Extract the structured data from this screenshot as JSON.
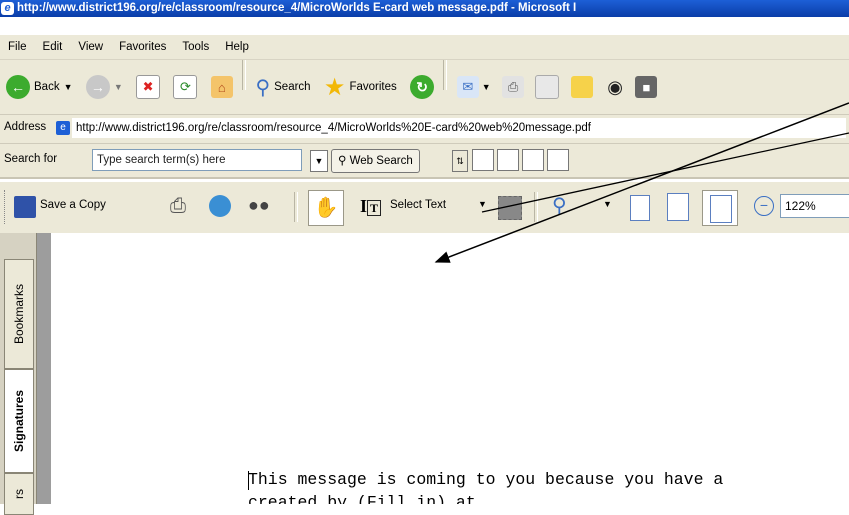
{
  "window": {
    "title": "http://www.district196.org/re/classroom/resource_4/MicroWorlds E-card web message.pdf - Microsoft I"
  },
  "menubar": {
    "items": [
      "File",
      "Edit",
      "View",
      "Favorites",
      "Tools",
      "Help"
    ]
  },
  "toolbar": {
    "back_label": "Back",
    "search_label": "Search",
    "favorites_label": "Favorites"
  },
  "address": {
    "label": "Address",
    "url": "http://www.district196.org/re/classroom/resource_4/MicroWorlds%20E-card%20web%20message.pdf"
  },
  "searchbar": {
    "label": "Search for",
    "placeholder": "Type search term(s) here",
    "web_search_label": "Web Search"
  },
  "reader": {
    "save_copy_label": "Save a Copy",
    "select_text_label": "Select Text",
    "zoom": "122%"
  },
  "side_tabs": {
    "bookmarks": "Bookmarks",
    "signatures": "Signatures",
    "layers": "rs"
  },
  "document": {
    "line1": "This message is coming to you because you have a",
    "line2": "created by (Fill in) at"
  }
}
